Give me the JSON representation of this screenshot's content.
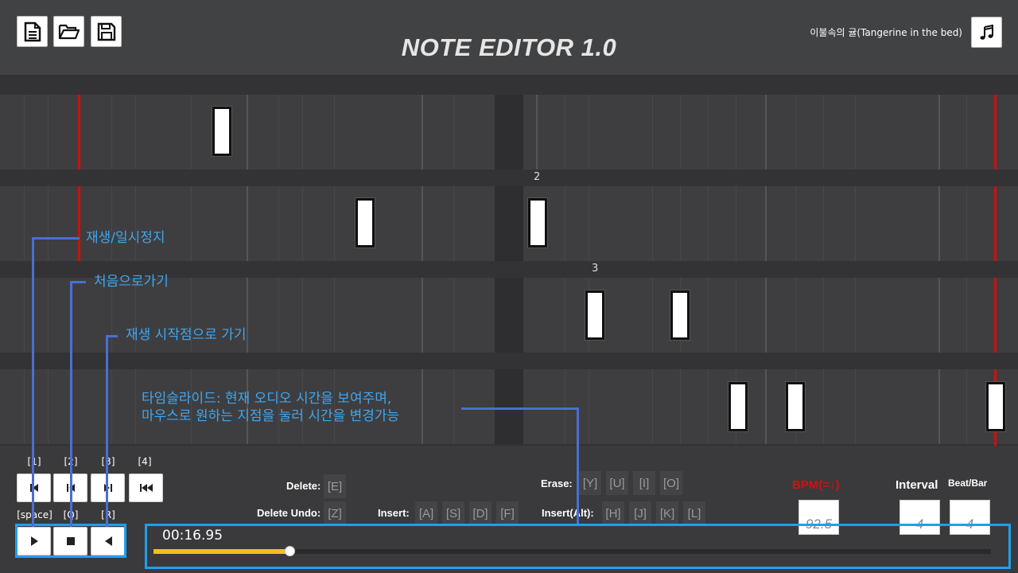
{
  "header": {
    "title": "NOTE EDITOR 1.0",
    "song_title": "이불속의 귤(Tangerine in the bed)",
    "buttons": [
      "new-file-icon",
      "open-folder-icon",
      "save-icon",
      "music-note-icon"
    ]
  },
  "grid": {
    "bar_numbers": [
      "2",
      "3"
    ]
  },
  "transport": {
    "top_hints": [
      "[1]",
      "[2]",
      "[3]",
      "[4]"
    ],
    "bottom_hints": [
      "[space]",
      "[Q]",
      "[R]"
    ]
  },
  "edit": {
    "delete_label": "Delete:",
    "delete_key": "[E]",
    "delete_undo_label": "Delete Undo:",
    "delete_undo_key": "[Z]",
    "insert_label": "Insert:",
    "insert_keys": [
      "[A]",
      "[S]",
      "[D]",
      "[F]"
    ],
    "erase_label": "Erase:",
    "erase_keys": [
      "[Y]",
      "[U]",
      "[I]",
      "[O]"
    ],
    "insert_alt_label": "Insert(Alt):",
    "insert_alt_keys": [
      "[H]",
      "[J]",
      "[K]",
      "[L]"
    ]
  },
  "settings": {
    "bpm_label": "BPM(=↓)",
    "bpm_value": "92.5",
    "interval_label": "Interval",
    "interval_value": "4",
    "beat_label": "Beat/Bar",
    "beat_value": "4"
  },
  "timeline": {
    "time": "00:16.95",
    "progress": 0.162
  },
  "annotations": {
    "play_pause": "재생/일시정지",
    "go_start": "처음으로가기",
    "go_play_start": "재생 시작점으로 가기",
    "time_slider_line1": "타임슬라이드: 현재 오디오 시간을 보여주며,",
    "time_slider_line2": "마우스로 원하는 지점을 눌러 시간을 변경가능"
  },
  "colors": {
    "accent_red": "#cc1010",
    "annotation_blue": "#3fa7f0",
    "highlight_blue": "#1ea0ec",
    "progress_yellow": "#f0c020"
  }
}
